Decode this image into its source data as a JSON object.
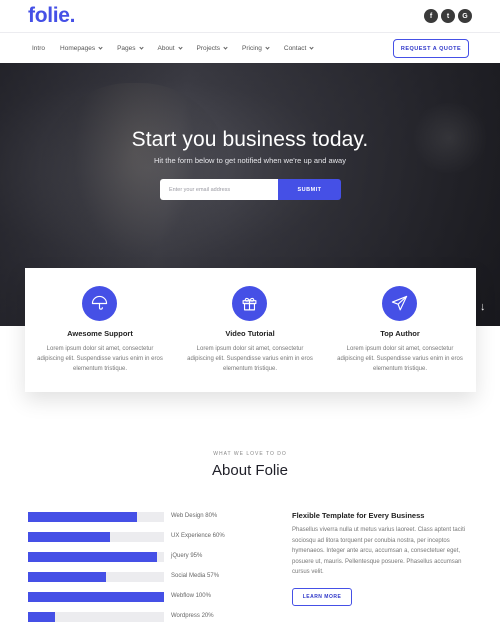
{
  "brand": {
    "logo_text": "folie.",
    "accent_color": "#4550e6"
  },
  "social": [
    {
      "icon": "facebook-icon",
      "glyph": "f"
    },
    {
      "icon": "twitter-icon",
      "glyph": "t"
    },
    {
      "icon": "google-icon",
      "glyph": "G"
    }
  ],
  "nav": {
    "items": [
      {
        "label": "Intro",
        "has_dropdown": false
      },
      {
        "label": "Homepages",
        "has_dropdown": true
      },
      {
        "label": "Pages",
        "has_dropdown": true
      },
      {
        "label": "About",
        "has_dropdown": true
      },
      {
        "label": "Projects",
        "has_dropdown": true
      },
      {
        "label": "Pricing",
        "has_dropdown": true
      },
      {
        "label": "Contact",
        "has_dropdown": true
      }
    ],
    "cta_label": "REQUEST A QUOTE"
  },
  "hero": {
    "title": "Start you business today.",
    "subtitle": "Hit the form below to get notified when we're up and away",
    "email_placeholder": "Enter your email address",
    "submit_label": "SUBMIT",
    "scroll_arrow": "↓"
  },
  "features": [
    {
      "icon": "umbrella-icon",
      "title": "Awesome Support",
      "text": "Lorem ipsum dolor sit amet, consectetur adipiscing elit. Suspendisse varius enim in eros elementum tristique."
    },
    {
      "icon": "gift-icon",
      "title": "Video Tutorial",
      "text": "Lorem ipsum dolor sit amet, consectetur adipiscing elit. Suspendisse varius enim in eros elementum tristique."
    },
    {
      "icon": "paper-plane-icon",
      "title": "Top Author",
      "text": "Lorem ipsum dolor sit amet, consectetur adipiscing elit. Suspendisse varius enim in eros elementum tristique."
    }
  ],
  "about": {
    "kicker": "WHAT WE LOVE TO DO",
    "title": "About Folie",
    "skills": [
      {
        "label": "Web Design 80%",
        "percent": 80
      },
      {
        "label": "UX Experience 60%",
        "percent": 60
      },
      {
        "label": "jQuery 95%",
        "percent": 95
      },
      {
        "label": "Social Media 57%",
        "percent": 57
      },
      {
        "label": "Webflow 100%",
        "percent": 100
      },
      {
        "label": "Wordpress 20%",
        "percent": 20
      }
    ],
    "template_title": "Flexible Template for Every Business",
    "template_text": "Phasellus viverra nulla ut metus varius laoreet. Class aptent taciti sociosqu ad litora torquent per conubia nostra, per inceptos hymenaeos. Integer ante arcu, accumsan a, consectetuer eget, posuere ut, mauris. Pellentesque posuere. Phasellus accumsan cursus velit.",
    "learn_more_label": "LEARN MORE"
  }
}
